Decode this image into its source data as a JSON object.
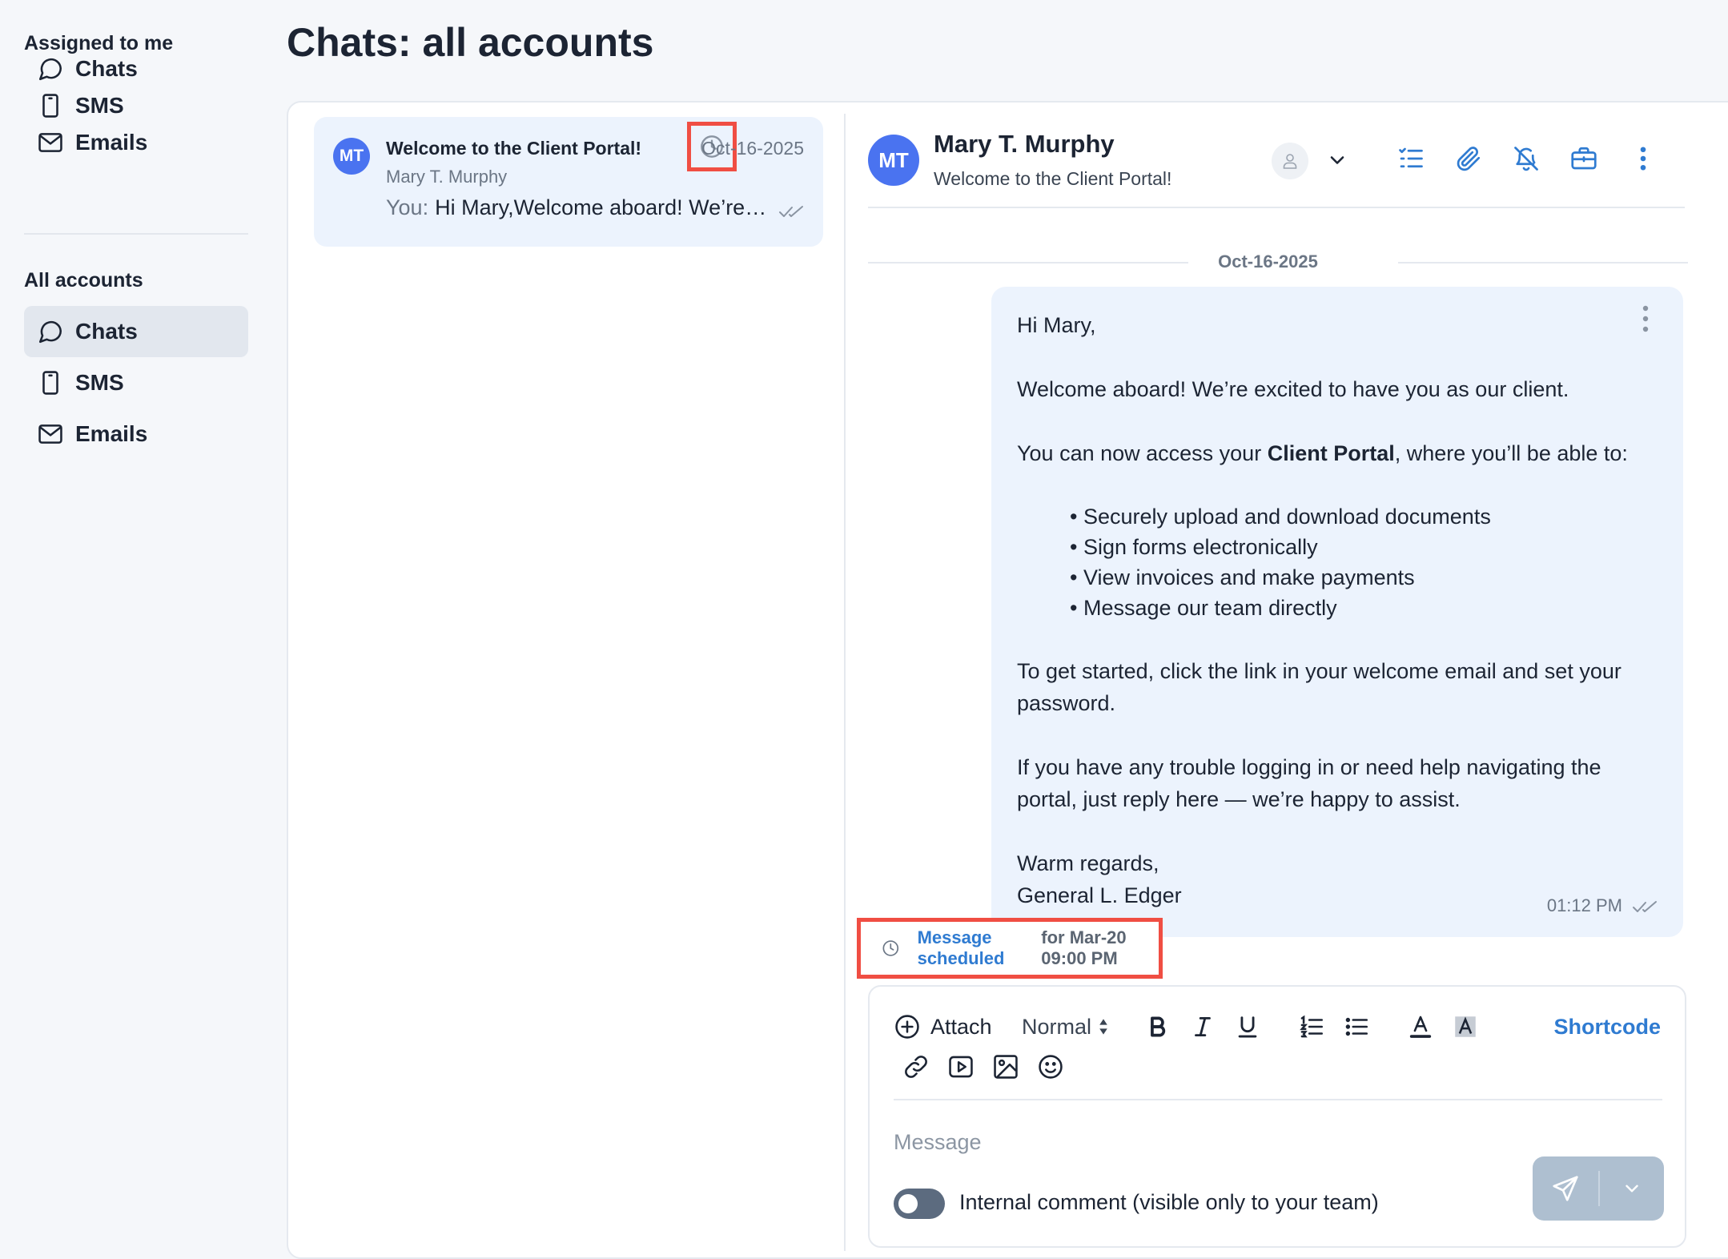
{
  "sidebar": {
    "assigned_heading": "Assigned to me",
    "assigned_items": [
      {
        "label": "Chats",
        "icon": "chat-bubble-icon"
      },
      {
        "label": "SMS",
        "icon": "phone-icon"
      },
      {
        "label": "Emails",
        "icon": "mail-icon"
      }
    ],
    "all_heading": "All accounts",
    "all_items": [
      {
        "label": "Chats",
        "icon": "chat-bubble-icon",
        "active": true
      },
      {
        "label": "SMS",
        "icon": "phone-icon"
      },
      {
        "label": "Emails",
        "icon": "mail-icon"
      }
    ]
  },
  "page": {
    "title": "Chats: all accounts"
  },
  "conversation": {
    "avatar_initials": "MT",
    "title": "Welcome to the Client Portal!",
    "sender": "Mary T. Murphy",
    "date": "Oct-16-2025",
    "preview_prefix": "You:",
    "preview_text": "Hi Mary,Welcome aboard! We’re…",
    "status_icon": "clock-icon"
  },
  "chat": {
    "avatar_initials": "MT",
    "name": "Mary T. Murphy",
    "subject": "Welcome to the Client Portal!",
    "date_separator": "Oct-16-2025",
    "message": {
      "greeting": "Hi Mary,",
      "line1": "Welcome aboard! We’re excited to have you as our client.",
      "line2_pre": "You can now access your ",
      "line2_bold": "Client Portal",
      "line2_post": ", where you’ll be able to:",
      "bullets": [
        "Securely upload and download documents",
        "Sign forms electronically",
        "View invoices and make payments",
        "Message our team directly"
      ],
      "para3": "To get started, click the link in your welcome email and set your password.",
      "para4": "If you have any trouble logging in or need help navigating the portal, just reply here — we’re happy to assist.",
      "closing": "Warm regards,",
      "signature": "General L. Edger",
      "time": "01:12 PM"
    },
    "scheduled": {
      "link_text": "Message scheduled",
      "rest_text": "for Mar-20 09:00 PM"
    }
  },
  "composer": {
    "attach_label": "Attach",
    "format_select": "Normal",
    "shortcode_label": "Shortcode",
    "message_placeholder": "Message",
    "internal_toggle_label": "Internal comment (visible only to your team)",
    "internal_toggle_on": false
  },
  "colors": {
    "accent": "#2f7bd1",
    "avatar": "#4a73f0",
    "highlight_box": "#f04e43",
    "bubble": "#ecf3fd"
  }
}
